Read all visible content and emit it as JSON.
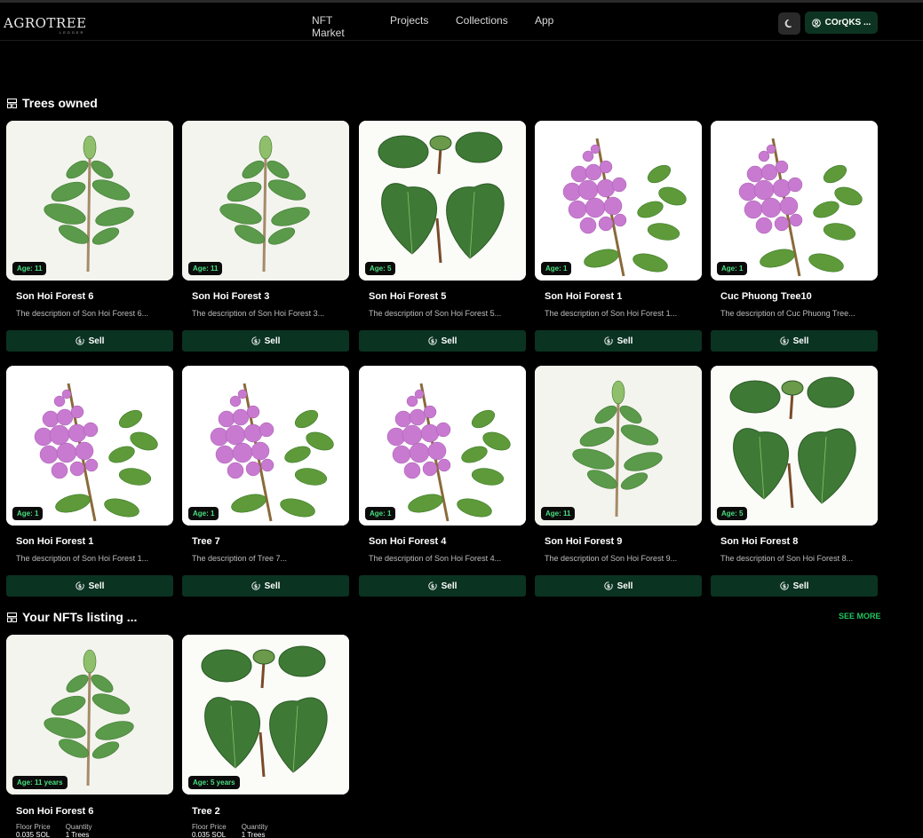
{
  "header": {
    "logo_text": "AGROTREE",
    "logo_sub": "LEDGER",
    "nav": [
      "NFT Market",
      "Projects",
      "Collections",
      "App"
    ],
    "wallet_label": "COrQKS ..."
  },
  "sections": {
    "owned_title": "Trees owned",
    "listing_title": "Your NFTs listing ...",
    "see_more": "SEE MORE"
  },
  "sell_label": "Sell",
  "owned": [
    {
      "name": "Son Hoi Forest 6",
      "desc": "The description of Son Hoi Forest 6...",
      "age": "Age: 11",
      "plant": "sapling"
    },
    {
      "name": "Son Hoi Forest 3",
      "desc": "The description of Son Hoi Forest 3...",
      "age": "Age: 11",
      "plant": "sapling"
    },
    {
      "name": "Son Hoi Forest 5",
      "desc": "The description of Son Hoi Forest 5...",
      "age": "Age: 5",
      "plant": "heart"
    },
    {
      "name": "Son Hoi Forest 1",
      "desc": "The description of Son Hoi Forest 1...",
      "age": "Age: 1",
      "plant": "flower"
    },
    {
      "name": "Cuc Phuong Tree10",
      "desc": "The description of Cuc Phuong Tree...",
      "age": "Age: 1",
      "plant": "flower"
    },
    {
      "name": "Son Hoi Forest 1",
      "desc": "The description of Son Hoi Forest 1...",
      "age": "Age: 1",
      "plant": "flower"
    },
    {
      "name": "Tree 7",
      "desc": "The description of Tree 7...",
      "age": "Age: 1",
      "plant": "flower"
    },
    {
      "name": "Son Hoi Forest 4",
      "desc": "The description of Son Hoi Forest 4...",
      "age": "Age: 1",
      "plant": "flower"
    },
    {
      "name": "Son Hoi Forest 9",
      "desc": "The description of Son Hoi Forest 9...",
      "age": "Age: 11",
      "plant": "sapling"
    },
    {
      "name": "Son Hoi Forest 8",
      "desc": "The description of Son Hoi Forest 8...",
      "age": "Age: 5",
      "plant": "heart"
    }
  ],
  "listing": [
    {
      "name": "Son Hoi Forest 6",
      "age": "Age: 11 years",
      "plant": "sapling",
      "floor_label": "Floor Price",
      "floor_value": "0.035 SOL",
      "qty_label": "Quantity",
      "qty_value": "1 Trees"
    },
    {
      "name": "Tree 2",
      "age": "Age: 5 years",
      "plant": "heart",
      "floor_label": "Floor Price",
      "floor_value": "0.035 SOL",
      "qty_label": "Quantity",
      "qty_value": "1 Trees"
    }
  ],
  "colors": {
    "accent": "#22c55e",
    "button_bg": "#0a3322",
    "page_bg": "#000000"
  }
}
